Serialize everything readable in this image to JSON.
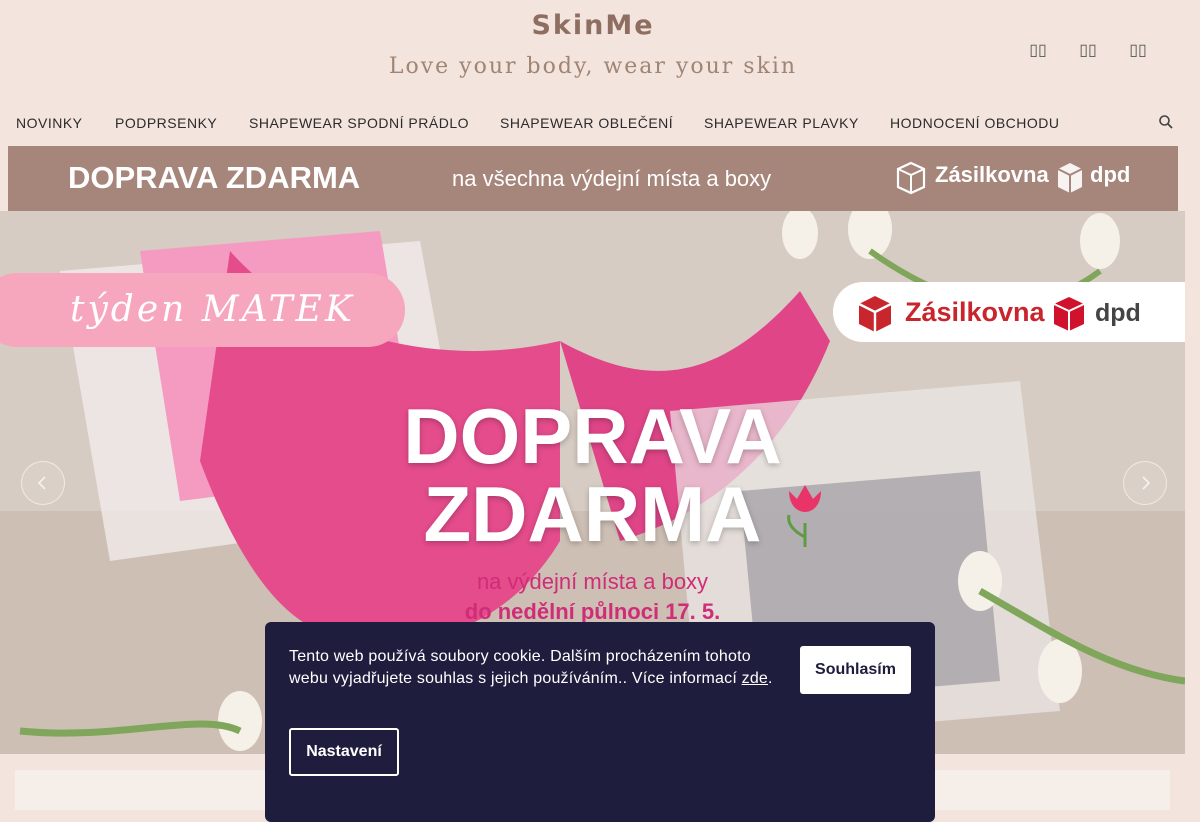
{
  "header": {
    "logo": "SkinMe",
    "tagline": "Love your body, wear your skin",
    "icons": [
      {
        "name": "account-icon",
        "glyph": "▯▯"
      },
      {
        "name": "wishlist-icon",
        "glyph": "▯▯"
      },
      {
        "name": "cart-icon",
        "glyph": "▯▯"
      }
    ]
  },
  "nav": {
    "items": [
      "NOVINKY",
      "PODPRSENKY",
      "SHAPEWEAR SPODNÍ PRÁDLO",
      "SHAPEWEAR OBLEČENÍ",
      "SHAPEWEAR PLAVKY",
      "HODNOCENÍ OBCHODU"
    ]
  },
  "shipping_banner": {
    "title": "DOPRAVA ZDARMA",
    "subtitle": "na všechna výdejní místa a boxy",
    "carrier1": "Zásilkovna",
    "carrier2": "dpd"
  },
  "hero": {
    "week_label": "týden MATEK",
    "carrier1": "Zásilkovna",
    "carrier2": "dpd",
    "line1": "DOPRAVA",
    "line2": "ZDARMA",
    "sub1": "na výdejní místa a boxy",
    "sub2": "do nedělní půlnoci 17. 5."
  },
  "cookie": {
    "text": "Tento web používá soubory cookie. Dalším procházením tohoto webu vyjadřujete souhlas s jejich používáním.. Více informací ",
    "link": "zde",
    "tail": ".",
    "agree_label": "Souhlasím",
    "settings_label": "Nastavení"
  },
  "colors": {
    "page_bg": "#f3e4dd",
    "banner_bg": "#a6857a",
    "brand": "#8e6e60",
    "pink": "#f6a6bd",
    "cookie_bg": "#1f1d3d"
  }
}
